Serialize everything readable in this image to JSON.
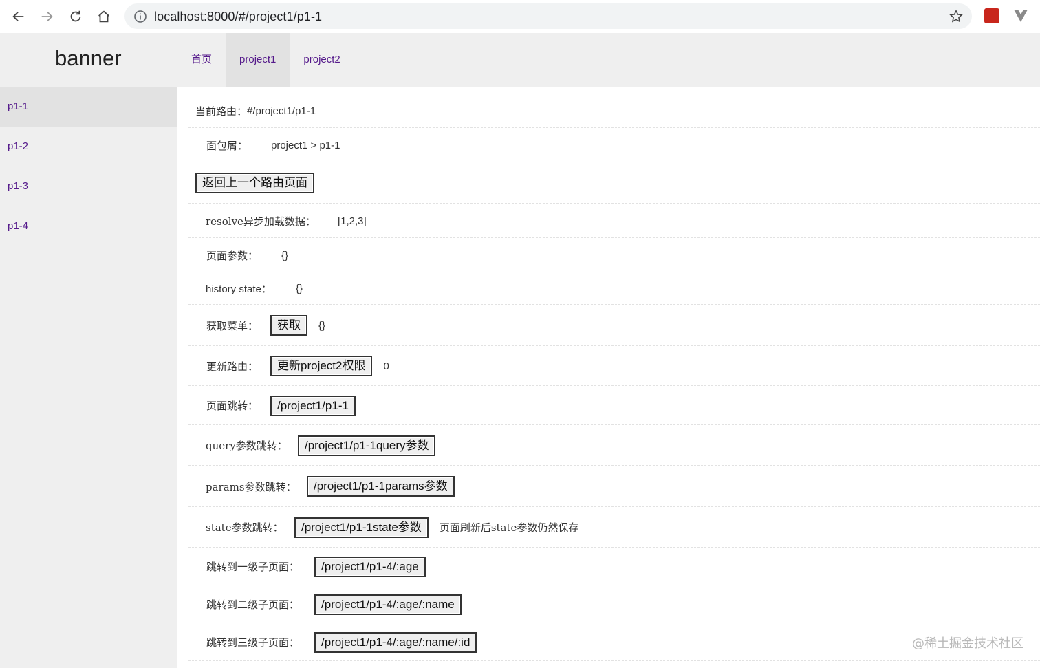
{
  "browser": {
    "url": "localhost:8000/#/project1/p1-1"
  },
  "header": {
    "banner": "banner",
    "nav": [
      {
        "label": "首页"
      },
      {
        "label": "project1"
      },
      {
        "label": "project2"
      }
    ]
  },
  "sidebar": {
    "items": [
      {
        "label": "p1-1"
      },
      {
        "label": "p1-2"
      },
      {
        "label": "p1-3"
      },
      {
        "label": "p1-4"
      }
    ]
  },
  "content": {
    "current_route_label": "当前路由：",
    "current_route_value": "#/project1/p1-1",
    "breadcrumb_label": "面包屑：",
    "breadcrumb_value": "project1 > p1-1",
    "back_button": "返回上一个路由页面",
    "resolve_label": "resolve异步加载数据：",
    "resolve_value": "[1,2,3]",
    "page_params_label": "页面参数：",
    "page_params_value": "{}",
    "history_state_label": "history state：",
    "history_state_value": "{}",
    "get_menu_label": "获取菜单：",
    "get_menu_button": "获取",
    "get_menu_value": "{}",
    "update_route_label": "更新路由：",
    "update_route_button": "更新project2权限",
    "update_route_value": "0",
    "page_jump_label": "页面跳转：",
    "page_jump_button": "/project1/p1-1",
    "query_jump_label": "query参数跳转：",
    "query_jump_button": "/project1/p1-1query参数",
    "params_jump_label": "params参数跳转：",
    "params_jump_button": "/project1/p1-1params参数",
    "state_jump_label": "state参数跳转：",
    "state_jump_button": "/project1/p1-1state参数",
    "state_jump_note": "页面刷新后state参数仍然保存",
    "level1_label": "跳转到一级子页面：",
    "level1_button": "/project1/p1-4/:age",
    "level2_label": "跳转到二级子页面：",
    "level2_button": "/project1/p1-4/:age/:name",
    "level3_label": "跳转到三级子页面：",
    "level3_button": "/project1/p1-4/:age/:name/:id"
  },
  "watermark": "@稀土掘金技术社区"
}
